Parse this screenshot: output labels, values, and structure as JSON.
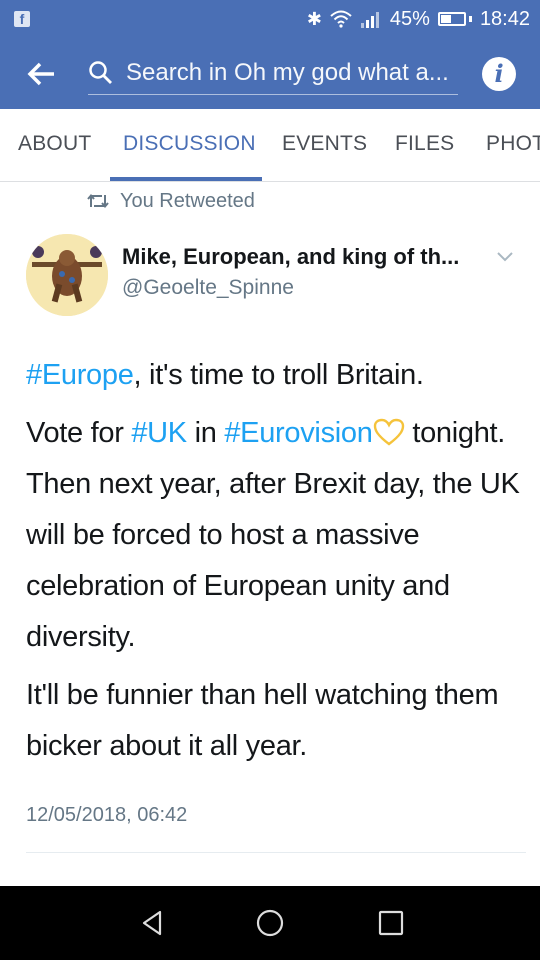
{
  "status_bar": {
    "battery": "45%",
    "time": "18:42",
    "battery_level": 0.45
  },
  "app_bar": {
    "search_placeholder": "Search in Oh my god what a..."
  },
  "tabs": [
    {
      "label": "ABOUT",
      "active": false
    },
    {
      "label": "DISCUSSION",
      "active": true
    },
    {
      "label": "EVENTS",
      "active": false
    },
    {
      "label": "FILES",
      "active": false
    },
    {
      "label": "PHOT",
      "active": false
    }
  ],
  "tweet": {
    "retweet_label": "You Retweeted",
    "author_name": "Mike, European, and king of th...",
    "author_handle": "@Geoelte_Spinne",
    "p1_tag": "#Europe",
    "p1_text": ", it's time to troll Britain.",
    "p2_a": "Vote for ",
    "p2_tag1": "#UK",
    "p2_b": " in ",
    "p2_tag2": "#Eurovision",
    "p2_c": " tonight. Then next year, after Brexit day, the UK will be forced to host a massive celebration of European unity and diversity.",
    "p3": "It'll be funnier than hell watching them bicker about it all year.",
    "timestamp": "12/05/2018, 06:42"
  },
  "colors": {
    "facebook_blue": "#4a6fb5",
    "twitter_link": "#1da1f2",
    "heart_yellow": "#f5c33b"
  }
}
